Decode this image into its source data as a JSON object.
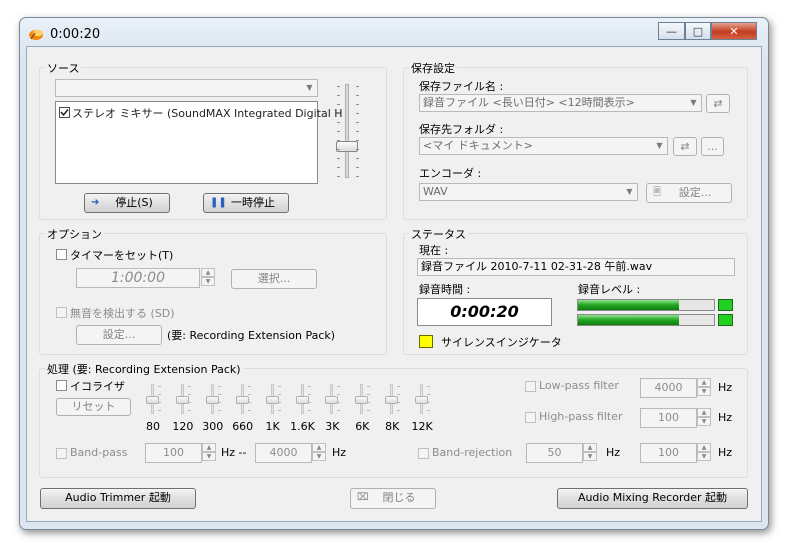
{
  "window": {
    "title": "0:00:20"
  },
  "source": {
    "group_label": "ソース",
    "device_combo": "",
    "list_items": [
      "ステレオ ミキサー (SoundMAX Integrated Digital H"
    ],
    "stop_label": "停止(S)",
    "pause_label": "一時停止"
  },
  "options": {
    "group_label": "オプション",
    "timer_label": "タイマーをセット(T)",
    "timer_value": "1:00:00",
    "select_label": "選択...",
    "silence_label": "無音を検出する (SD)",
    "settings_label": "設定...",
    "requires_label": "(要: Recording Extension Pack)"
  },
  "save": {
    "group_label": "保存設定",
    "filename_label": "保存ファイル名 :",
    "filename_value": "録音ファイル <長い日付> <12時間表示>",
    "folder_label": "保存先フォルダ :",
    "folder_value": "<マイ ドキュメント>",
    "browse_label": "...",
    "encoder_label": "エンコーダ :",
    "encoder_value": "WAV",
    "encoder_settings_label": "設定..."
  },
  "status": {
    "group_label": "ステータス",
    "current_label": "現在 :",
    "current_value": "録音ファイル 2010-7-11 02-31-28 午前.wav",
    "time_label": "録音時間 :",
    "time_value": "0:00:20",
    "level_label": "録音レベル :",
    "level_left": 0.74,
    "level_right": 0.74,
    "silence_indicator_label": "サイレンスインジケータ"
  },
  "processing": {
    "group_label": "処理 (要: Recording Extension Pack)",
    "equalizer_label": "イコライザ",
    "reset_label": "リセット",
    "eq_bands": [
      "80",
      "120",
      "300",
      "660",
      "1K",
      "1.6K",
      "3K",
      "6K",
      "8K",
      "12K"
    ],
    "lowpass_label": "Low-pass filter",
    "lowpass_value": "4000",
    "highpass_label": "High-pass filter",
    "highpass_value": "100",
    "hz": "Hz",
    "bandpass_label": "Band-pass",
    "bandpass_from": "100",
    "bandpass_to": "4000",
    "range_sep": "Hz --",
    "bandrejection_label": "Band-rejection",
    "bandrejection_center": "50",
    "bandrejection_width": "100"
  },
  "footer": {
    "trimmer_label": "Audio Trimmer 起動",
    "close_label": "閉じる",
    "mixing_label": "Audio Mixing Recorder 起動"
  },
  "colors": {
    "meter_green": "#22a622",
    "silence_yellow": "#ffff00",
    "accent_blue": "#2060c0"
  }
}
